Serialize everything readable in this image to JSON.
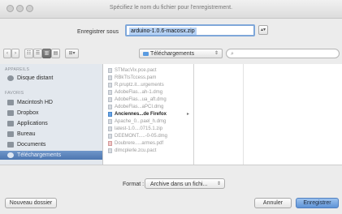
{
  "window": {
    "title": "Spécifiez le nom du fichier pour l'enregistrement."
  },
  "save": {
    "label": "Enregistrer sous",
    "filename": "arduino-1.0.6-macosx.zip",
    "expand_icon": "chevron-up-down-icon"
  },
  "toolbar": {
    "back_icon": "‹",
    "forward_icon": "›",
    "view_icons": [
      "☷",
      "☰",
      "▥",
      "▤"
    ],
    "arrange_icon": "⊞▾",
    "location": "Téléchargements",
    "search_placeholder": ""
  },
  "sidebar": {
    "sections": [
      {
        "label": "APPAREILS",
        "items": [
          {
            "label": "Disque distant",
            "icon": "disc-icon"
          }
        ]
      },
      {
        "label": "FAVORIS",
        "items": [
          {
            "label": "Macintosh HD",
            "icon": "hard-drive-icon"
          },
          {
            "label": "Dropbox",
            "icon": "dropbox-icon"
          },
          {
            "label": "Applications",
            "icon": "applications-icon"
          },
          {
            "label": "Bureau",
            "icon": "desktop-icon"
          },
          {
            "label": "Documents",
            "icon": "documents-icon"
          },
          {
            "label": "Téléchargements",
            "icon": "downloads-icon",
            "selected": true
          }
        ]
      }
    ]
  },
  "files": [
    {
      "name": "STMacVix.pce.pact",
      "kind": "file"
    },
    {
      "name": "RBkTtsTccess.pam",
      "kind": "file"
    },
    {
      "name": "R.pruptz.it...urgements",
      "kind": "file"
    },
    {
      "name": "AdobeFlas...ah-1.dmg",
      "kind": "file"
    },
    {
      "name": "AdobeFlas...ua_aft.dmg",
      "kind": "file"
    },
    {
      "name": "AdobeFlas...aPCI.dmg",
      "kind": "file"
    },
    {
      "name": "Anciennes...de Firefox",
      "kind": "folder"
    },
    {
      "name": "Apache_0...pael_h.dmg",
      "kind": "file"
    },
    {
      "name": "latest-1.0....0715.1.zip",
      "kind": "file"
    },
    {
      "name": "DEEMONT.....-0-05.dmg",
      "kind": "file"
    },
    {
      "name": "Doubrere.....armes.pdf",
      "kind": "file"
    },
    {
      "name": "dlmcplerle.zcu.pact",
      "kind": "file"
    }
  ],
  "format": {
    "label": "Format :",
    "value": "Archive dans un fichi..."
  },
  "buttons": {
    "new_folder": "Nouveau dossier",
    "cancel": "Annuler",
    "save": "Enregistrer"
  }
}
